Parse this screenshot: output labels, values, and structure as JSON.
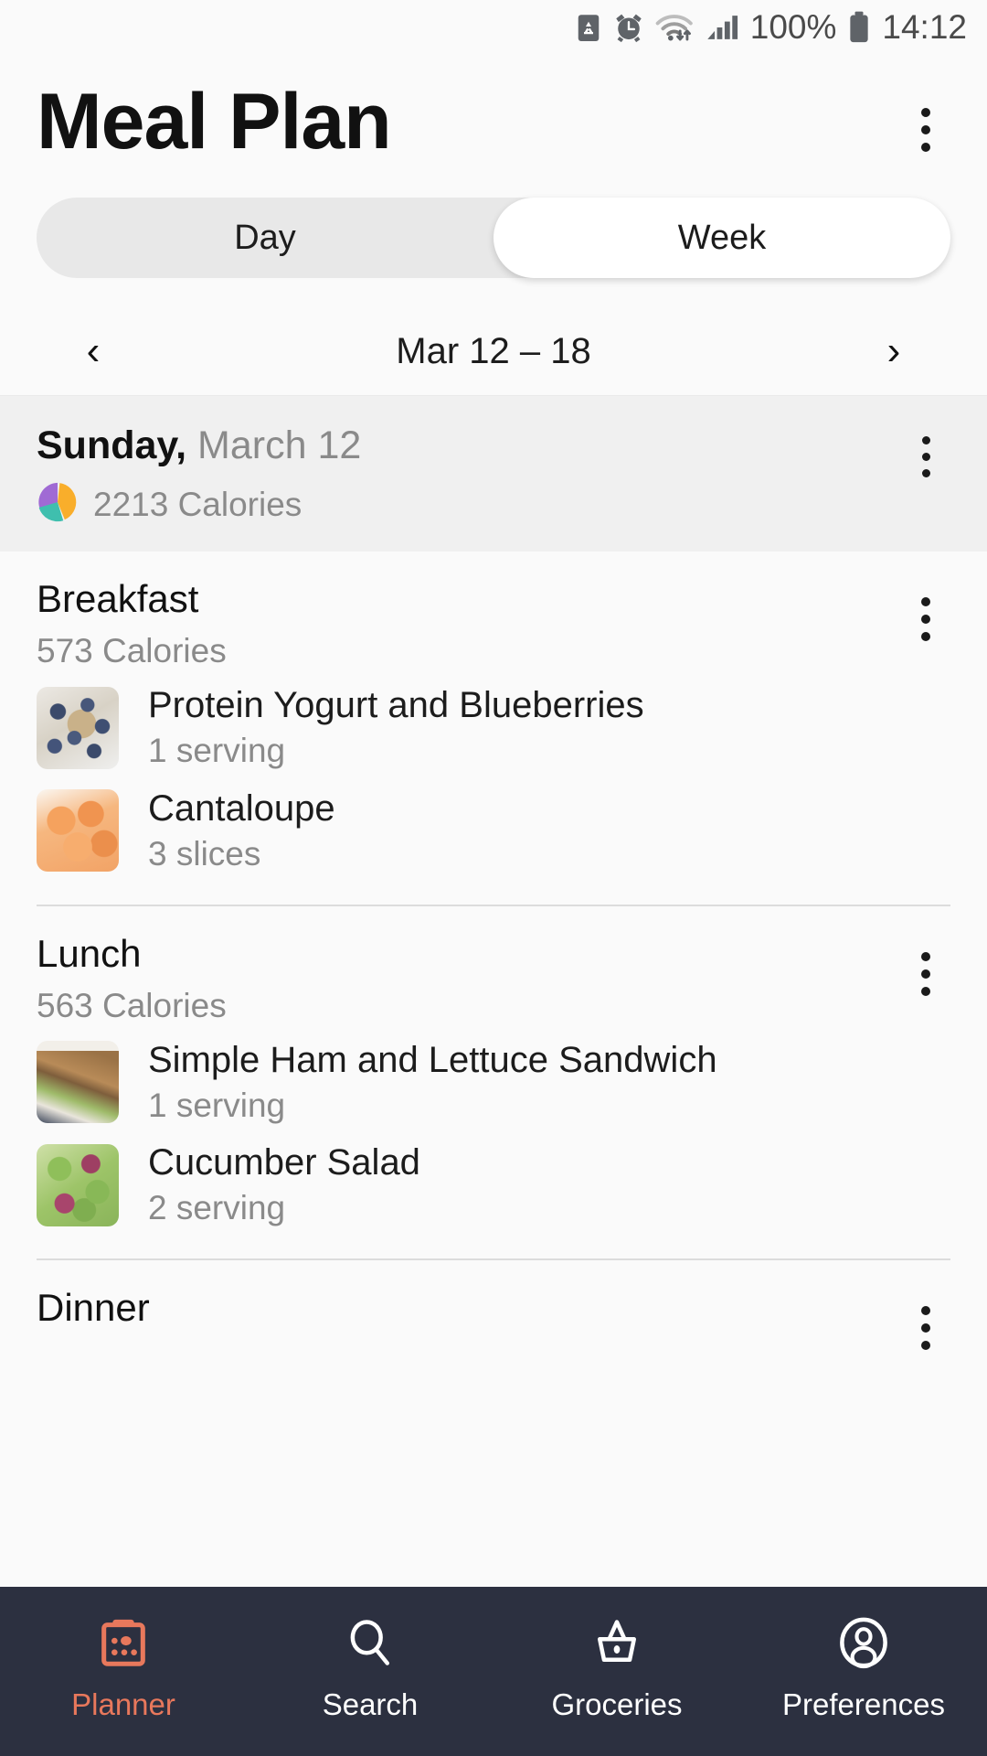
{
  "statusbar": {
    "icons": [
      "clipboard-recycle-icon",
      "alarm-clock-icon",
      "wifi-icon",
      "cellular-signal-icon",
      "battery-icon"
    ],
    "battery_percent": "100%",
    "time": "14:12"
  },
  "header": {
    "title": "Meal Plan",
    "overflow_menu": "overflow-menu"
  },
  "segmented": {
    "options": [
      {
        "label": "Day",
        "selected": false
      },
      {
        "label": "Week",
        "selected": true
      }
    ]
  },
  "datenav": {
    "prev": "‹",
    "next": "›",
    "range": "Mar 12 – 18"
  },
  "day": {
    "weekday": "Sunday,",
    "date": "March 12",
    "calories": "2213 Calories",
    "pie_colors": {
      "protein": "#A06AD4",
      "carbs": "#F9AE2B",
      "fat": "#3FBFAE"
    }
  },
  "meals": [
    {
      "name": "Breakfast",
      "calories": "573 Calories",
      "items": [
        {
          "name": "Protein Yogurt and Blueberries",
          "serving": "1 serving",
          "thumb": "th-yogurt",
          "thumb_name": "yogurt-blueberries-thumbnail"
        },
        {
          "name": "Cantaloupe",
          "serving": "3 slices",
          "thumb": "th-cantaloupe",
          "thumb_name": "cantaloupe-thumbnail"
        }
      ]
    },
    {
      "name": "Lunch",
      "calories": "563 Calories",
      "items": [
        {
          "name": "Simple Ham and Lettuce Sandwich",
          "serving": "1 serving",
          "thumb": "th-sandwich",
          "thumb_name": "ham-sandwich-thumbnail"
        },
        {
          "name": "Cucumber Salad",
          "serving": "2 serving",
          "thumb": "th-cucumber",
          "thumb_name": "cucumber-salad-thumbnail"
        }
      ]
    },
    {
      "name": "Dinner",
      "calories": "",
      "items": []
    }
  ],
  "bottomnav": {
    "items": [
      {
        "label": "Planner",
        "icon": "calendar-planner-icon",
        "active": true
      },
      {
        "label": "Search",
        "icon": "search-icon",
        "active": false
      },
      {
        "label": "Groceries",
        "icon": "basket-icon",
        "active": false
      },
      {
        "label": "Preferences",
        "icon": "person-circle-icon",
        "active": false
      }
    ],
    "accent_color": "#E8785C",
    "background_color": "#2C3040"
  }
}
